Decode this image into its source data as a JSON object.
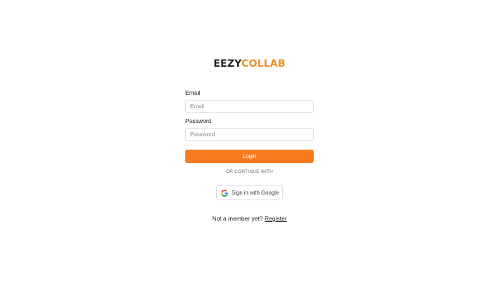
{
  "brand": {
    "part_a": "EEZY",
    "part_b": "COLLAB",
    "color_a": "#222222",
    "color_b": "#f0902a"
  },
  "form": {
    "email_label": "Email",
    "email_placeholder": "Email",
    "email_value": "",
    "password_label": "Password",
    "password_placeholder": "Password",
    "password_value": "",
    "login_label": "Login",
    "divider_text": "OR CONTINUE WITH"
  },
  "google": {
    "label": "Sign in with Google",
    "icon": "google-icon"
  },
  "register": {
    "prompt": "Not a member yet?",
    "link_label": "Register"
  },
  "colors": {
    "accent": "#f77a1e",
    "border": "#dcdcdc"
  }
}
